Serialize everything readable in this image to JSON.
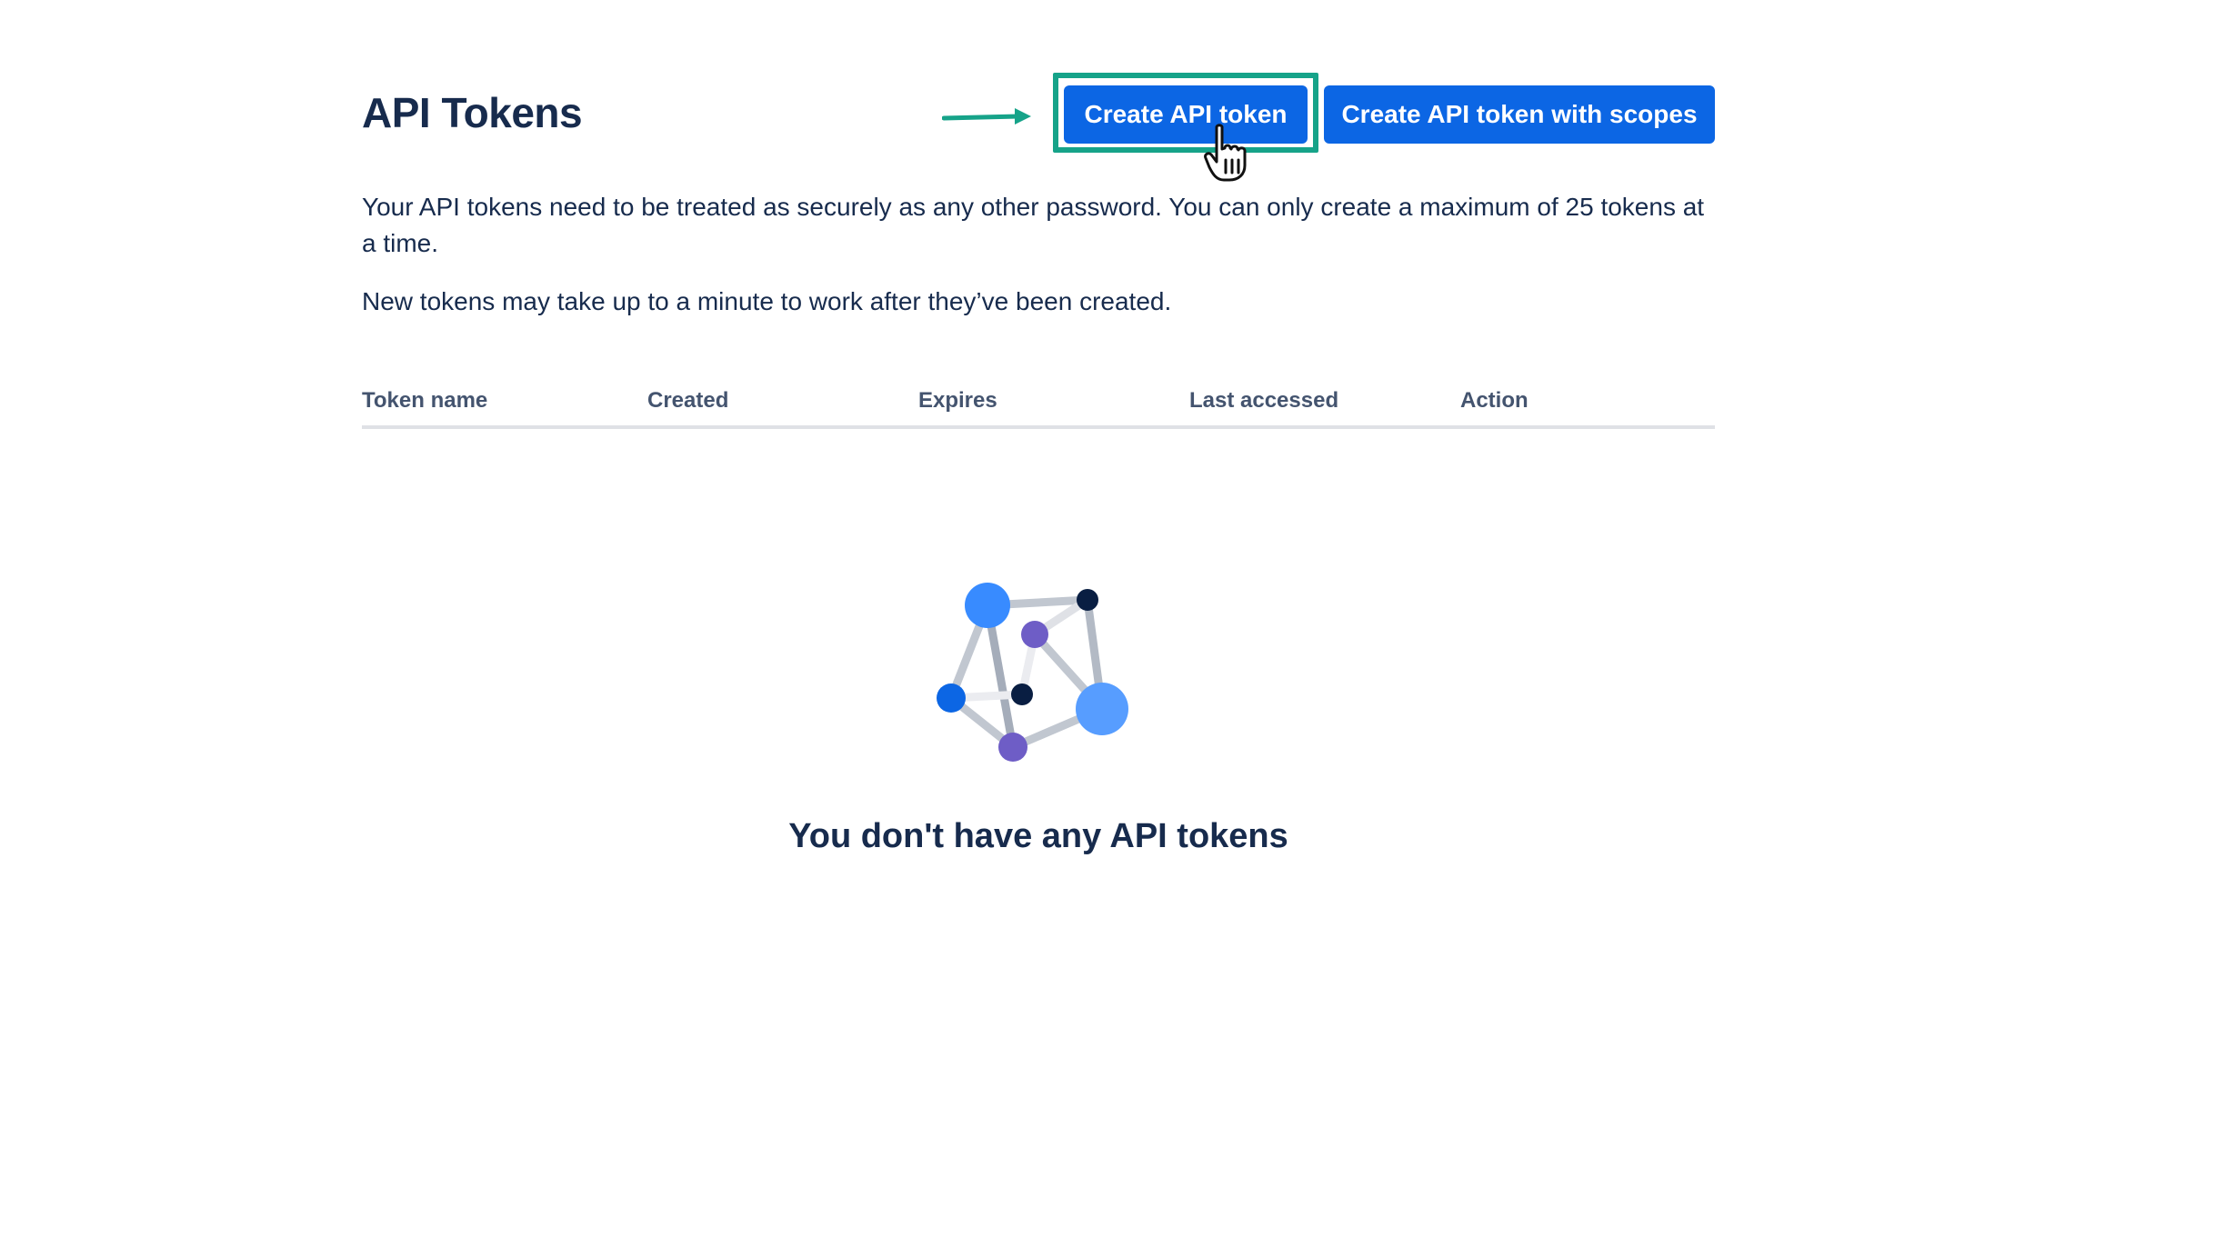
{
  "header": {
    "title": "API Tokens",
    "create_button_label": "Create API token",
    "create_scopes_button_label": "Create API token with scopes"
  },
  "description": {
    "paragraph_1": "Your API tokens need to be treated as securely as any other password. You can only create a maximum of 25 tokens at a time.",
    "paragraph_2": "New tokens may take up to a minute to work after they’ve been created."
  },
  "table": {
    "columns": [
      "Token name",
      "Created",
      "Expires",
      "Last accessed",
      "Action"
    ],
    "rows": []
  },
  "empty_state": {
    "message": "You don't have any API tokens"
  },
  "colors": {
    "primary_button": "#0c66e4",
    "highlight": "#16a389",
    "text": "#172b4d"
  },
  "icons": [
    "arrow-right-icon",
    "hand-pointer-cursor-icon",
    "network-nodes-illustration"
  ]
}
